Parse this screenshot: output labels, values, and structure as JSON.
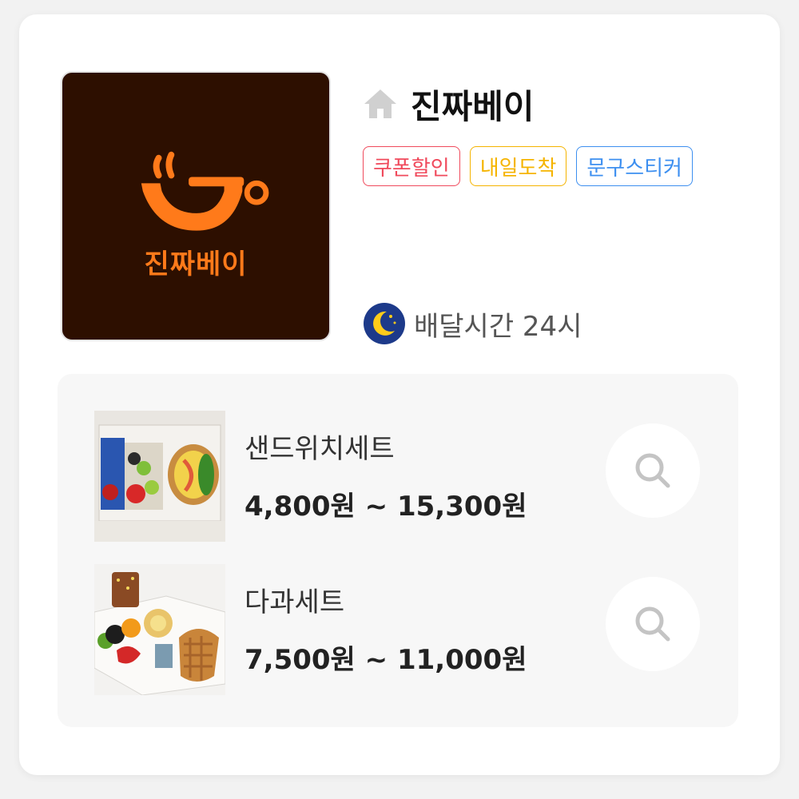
{
  "store": {
    "name": "진짜베이",
    "logo_text": "진짜베이",
    "home_icon": "home-icon",
    "tags": [
      {
        "label": "쿠폰할인",
        "color": "#f04a5c"
      },
      {
        "label": "내일도착",
        "color": "#f5b400"
      },
      {
        "label": "문구스티커",
        "color": "#3d8ff0"
      }
    ],
    "delivery": {
      "icon": "moon-icon",
      "label": "배달시간 24시"
    }
  },
  "products": [
    {
      "name": "샌드위치세트",
      "price": "4,800원 ~ 15,300원",
      "image": "sandwich-set-photo",
      "action_icon": "search-icon"
    },
    {
      "name": "다과세트",
      "price": "7,500원 ~ 11,000원",
      "image": "dessert-set-photo",
      "action_icon": "search-icon"
    }
  ],
  "colors": {
    "logo_bg": "#2d0f00",
    "logo_accent": "#ff7a1a",
    "moon_bg": "#1d3a8a"
  }
}
